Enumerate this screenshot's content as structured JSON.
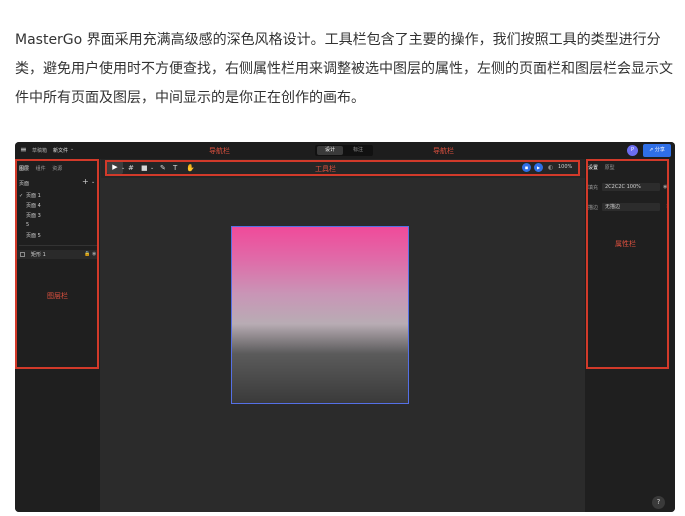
{
  "intro_text": "MasterGo 界面采用充满高级感的深色风格设计。工具栏包含了主要的操作，我们按照工具的类型进行分类，避免用户使用时不方便查找，右侧属性栏用来调整被选中图层的属性，左侧的页面栏和图层栏会显示文件中所有页面及图层，中间显示的是你正在创作的画布。",
  "topbar": {
    "menu_icon": "≡",
    "crumb_team": "草稿箱",
    "crumb_file": "新文件",
    "crumb_caret": "⌄",
    "nav_label_left": "导航栏",
    "nav_label_right": "导航栏",
    "tab_design": "设计",
    "tab_prototype": "标注",
    "avatar_initial": "P",
    "share_label": "⇗ 分享"
  },
  "left_panel": {
    "tabs": [
      "图层",
      "组件",
      "资源"
    ],
    "pages_label": "页面",
    "add_icon": "+",
    "collapse_icon": "⌄",
    "pages": [
      {
        "label": "页面 1",
        "checked": true
      },
      {
        "label": "页面 4",
        "checked": false
      },
      {
        "label": "页面 3",
        "checked": false
      },
      {
        "label": "5",
        "checked": false
      },
      {
        "label": "页面 5",
        "checked": false
      }
    ],
    "layer": {
      "label": "矩形 1",
      "lock": "🔒",
      "eye": "◉"
    },
    "annotation": "图层栏"
  },
  "toolbar": {
    "annotation": "工具栏",
    "tools": [
      "▶",
      "⌄",
      "#",
      "■",
      "⌄",
      "✎",
      "T",
      "✋"
    ],
    "zoom": "100%",
    "zoom_caret": "⌄"
  },
  "right_panel": {
    "tabs": [
      "设置",
      "原型"
    ],
    "fill_label": "填充",
    "fill_value": "2C2C2C  100%",
    "stroke_label": "描边",
    "stroke_value": "无描边",
    "eye": "◉",
    "annotation": "属性栏"
  },
  "help_label": "?"
}
